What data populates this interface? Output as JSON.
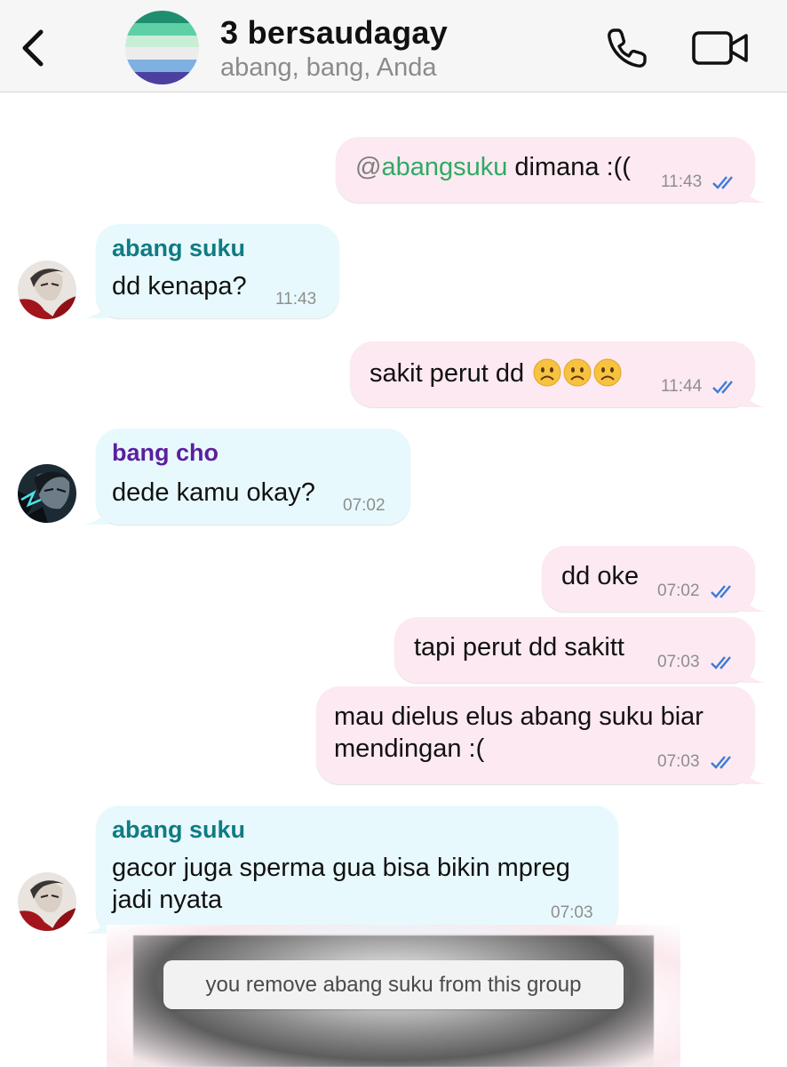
{
  "header": {
    "title": "3 bersaudagay",
    "subtitle": "abang, bang, Anda",
    "icons": [
      "chevron-left-icon",
      "group-avatar",
      "phone-icon",
      "video-camera-icon"
    ]
  },
  "colors": {
    "outgoing_bubble": "#fde9f1",
    "incoming_bubble": "#e8f9fd",
    "sender_abang_suku": "#0f7c82",
    "sender_bang_cho": "#5a1f9e",
    "mention": "#2eaa64",
    "read_ticks": "#3b7bd8"
  },
  "messages": [
    {
      "dir": "out",
      "mention_at": "@",
      "mention": "abangsuku",
      "text": " dimana :((",
      "time": "11:43",
      "status": "read"
    },
    {
      "dir": "in",
      "sender": "abang suku",
      "text": "dd kenapa?",
      "time": "11:43"
    },
    {
      "dir": "out",
      "text": "sakit perut dd",
      "emojis": [
        "frowning-face",
        "frowning-face",
        "frowning-face"
      ],
      "time": "11:44",
      "status": "read"
    },
    {
      "dir": "in",
      "sender": "bang cho",
      "text": "dede kamu okay?",
      "time": "07:02"
    },
    {
      "dir": "out",
      "text": "dd oke",
      "time": "07:02",
      "status": "read"
    },
    {
      "dir": "out",
      "text": "tapi perut dd sakitt",
      "time": "07:03",
      "status": "read"
    },
    {
      "dir": "out",
      "lines": [
        "mau dielus elus abang suku biar",
        "mendingan :("
      ],
      "time": "07:03",
      "status": "read"
    },
    {
      "dir": "in",
      "sender": "abang suku",
      "lines": [
        "gacor juga sperma gua bisa bikin mpreg",
        "jadi nyata"
      ],
      "time": "07:03"
    }
  ],
  "system_message": "you remove abang suku from this group"
}
